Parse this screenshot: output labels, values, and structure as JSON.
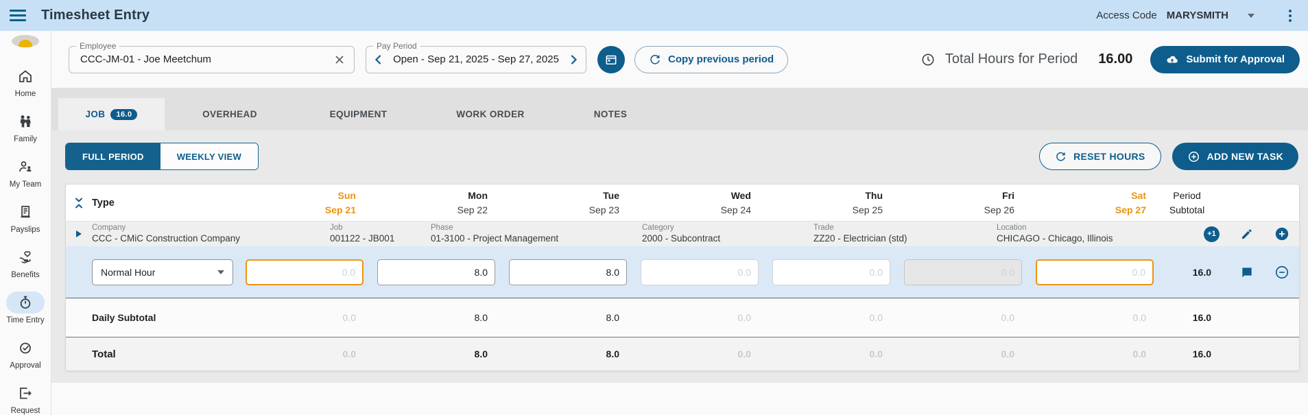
{
  "topbar": {
    "title": "Timesheet Entry",
    "access_code_label": "Access Code",
    "access_code_value": "MARYSMITH"
  },
  "toolbar": {
    "employee": {
      "label": "Employee",
      "value": "CCC-JM-01 - Joe Meetchum"
    },
    "pay_period": {
      "label": "Pay Period",
      "value": "Open - Sep 21, 2025 - Sep 27, 2025"
    },
    "copy_button": "Copy previous period",
    "total_hours_label": "Total Hours for Period",
    "total_hours_value": "16.00",
    "submit_button": "Submit for Approval"
  },
  "sidebar": {
    "items": [
      {
        "label": "Home",
        "state": ""
      },
      {
        "label": "Family",
        "state": ""
      },
      {
        "label": "My Team",
        "state": ""
      },
      {
        "label": "Payslips",
        "state": ""
      },
      {
        "label": "Benefits",
        "state": ""
      },
      {
        "label": "Time Entry",
        "state": "active"
      },
      {
        "label": "Approval",
        "state": ""
      },
      {
        "label": "Request",
        "state": ""
      }
    ]
  },
  "tabs": [
    {
      "label": "JOB",
      "badge": "16.0",
      "state": "active"
    },
    {
      "label": "OVERHEAD",
      "state": ""
    },
    {
      "label": "EQUIPMENT",
      "state": ""
    },
    {
      "label": "WORK ORDER",
      "state": ""
    },
    {
      "label": "NOTES",
      "state": ""
    }
  ],
  "view_toggle": {
    "full": {
      "label": "FULL PERIOD",
      "state": "active"
    },
    "weekly": {
      "label": "WEEKLY VIEW",
      "state": ""
    }
  },
  "actions": {
    "reset": "RESET HOURS",
    "add": "ADD NEW TASK"
  },
  "table": {
    "type_header": "Type",
    "period_subtotal_header_1": "Period",
    "period_subtotal_header_2": "Subtotal",
    "days": [
      {
        "name": "Sun",
        "date": "Sep 21",
        "tone": "weekend"
      },
      {
        "name": "Mon",
        "date": "Sep 22",
        "tone": "weekday"
      },
      {
        "name": "Tue",
        "date": "Sep 23",
        "tone": "weekday"
      },
      {
        "name": "Wed",
        "date": "Sep 24",
        "tone": "weekday"
      },
      {
        "name": "Thu",
        "date": "Sep 25",
        "tone": "weekday"
      },
      {
        "name": "Fri",
        "date": "Sep 26",
        "tone": "weekday"
      },
      {
        "name": "Sat",
        "date": "Sep 27",
        "tone": "weekend"
      }
    ],
    "task": {
      "company": {
        "label": "Company",
        "value": "CCC - CMiC Construction Company"
      },
      "job": {
        "label": "Job",
        "value": "001122 - JB001"
      },
      "phase": {
        "label": "Phase",
        "value": "01-3100 - Project Management"
      },
      "category": {
        "label": "Category",
        "value": "2000 - Subcontract"
      },
      "trade": {
        "label": "Trade",
        "value": "ZZ20 - Electrician (std)"
      },
      "location": {
        "label": "Location",
        "value": "CHICAGO - Chicago, Illinois"
      },
      "more_badge": "+1"
    },
    "entry": {
      "type_value": "Normal Hour",
      "cells": [
        {
          "value": "",
          "placeholder": "0.0",
          "state": "weekend"
        },
        {
          "value": "8.0",
          "placeholder": "0.0",
          "state": "filled"
        },
        {
          "value": "8.0",
          "placeholder": "0.0",
          "state": "filled"
        },
        {
          "value": "",
          "placeholder": "0.0",
          "state": "normal"
        },
        {
          "value": "",
          "placeholder": "0.0",
          "state": "normal"
        },
        {
          "value": "",
          "placeholder": "0.0",
          "state": "disabled"
        },
        {
          "value": "",
          "placeholder": "0.0",
          "state": "weekend"
        }
      ],
      "subtotal": "16.0"
    },
    "daily_subtotal": {
      "label": "Daily Subtotal",
      "values": [
        "0.0",
        "8.0",
        "8.0",
        "0.0",
        "0.0",
        "0.0",
        "0.0"
      ],
      "total": "16.0"
    },
    "total": {
      "label": "Total",
      "values": [
        "0.0",
        "8.0",
        "8.0",
        "0.0",
        "0.0",
        "0.0",
        "0.0"
      ],
      "total": "16.0"
    }
  },
  "colors": {
    "accent": "#0E5D8D",
    "weekend_orange": "#ED940D",
    "topbar_blue": "#C7E0F5",
    "entry_row_blue": "#DBE9F7"
  }
}
